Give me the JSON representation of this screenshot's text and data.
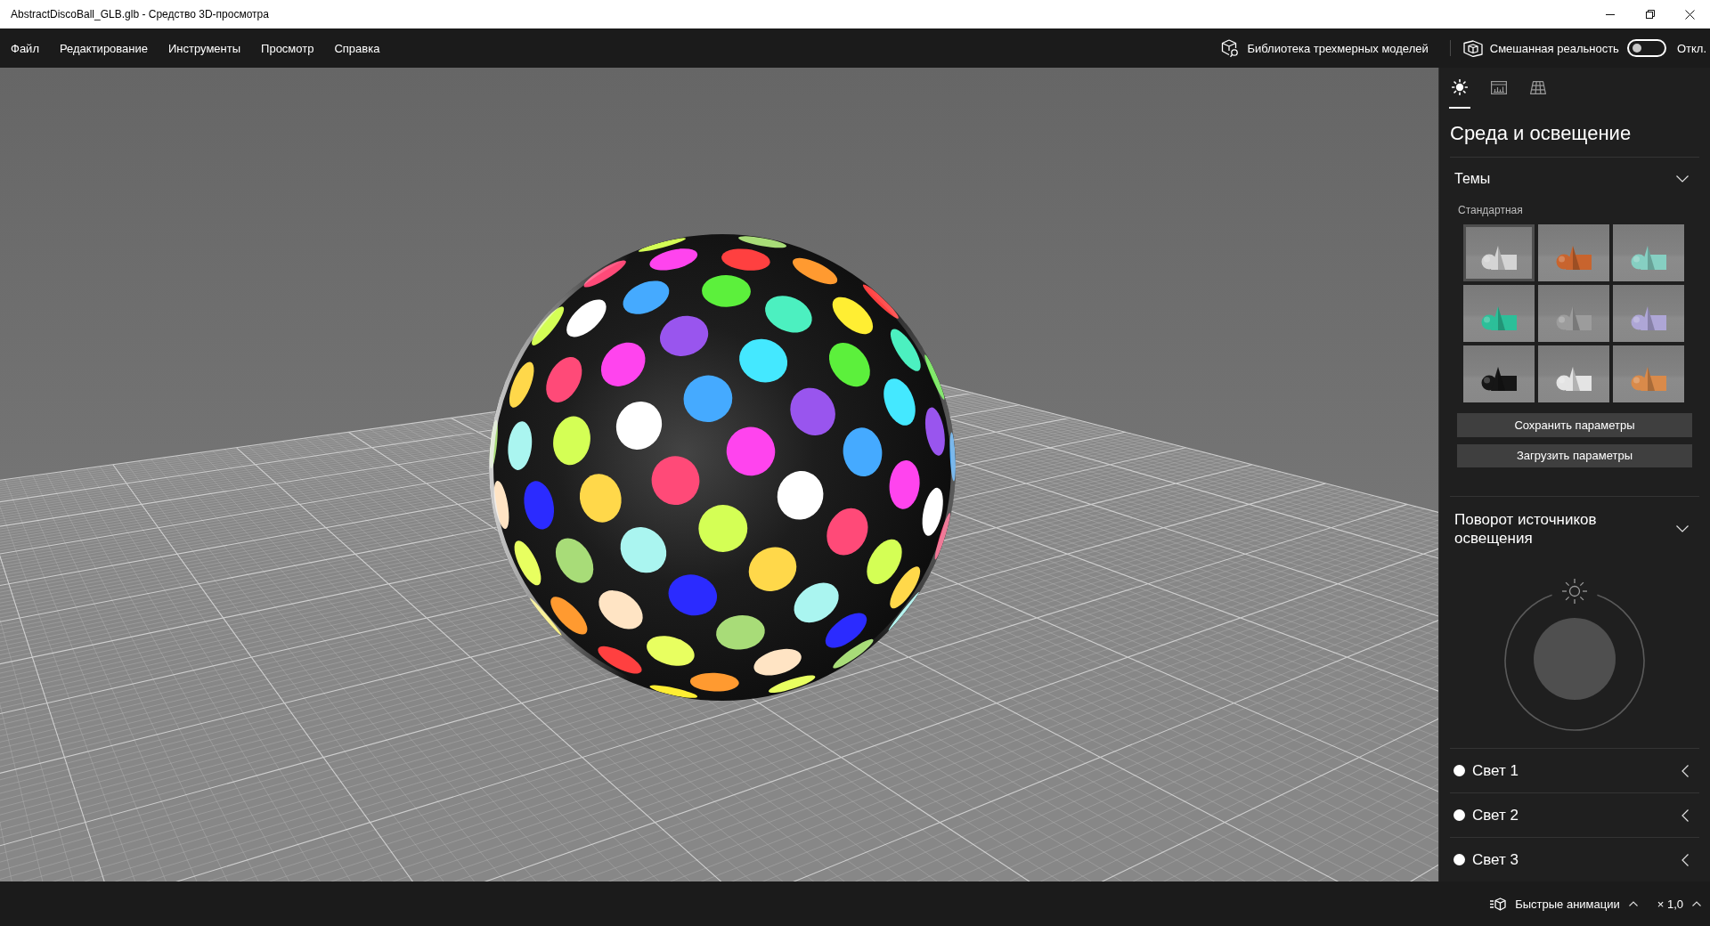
{
  "window": {
    "title": "AbstractDiscoBall_GLB.glb - Средство 3D-просмотра"
  },
  "menu_bar": {
    "items": [
      "Файл",
      "Редактирование",
      "Инструменты",
      "Просмотр",
      "Справка"
    ],
    "library_link": "Библиотека трехмерных моделей",
    "mixed_reality": {
      "label": "Смешанная реальность",
      "on": false,
      "state_text": "Откл."
    }
  },
  "side_panel": {
    "tabs": [
      {
        "selected": true
      },
      {
        "selected": false
      },
      {
        "selected": false
      }
    ],
    "title": "Среда и освещение",
    "themes": {
      "heading": "Темы",
      "expanded": true,
      "group_label": "Стандартная",
      "tiles": [
        {
          "color": "#d4d4d4",
          "selected": true
        },
        {
          "color": "#c8642e",
          "selected": false
        },
        {
          "color": "#86cfc2",
          "selected": false
        },
        {
          "color": "#2cbf99",
          "selected": false
        },
        {
          "color": "#9c9c9c",
          "selected": false
        },
        {
          "color": "#aea6d6",
          "selected": false
        },
        {
          "color": "#161616",
          "selected": false
        },
        {
          "color": "#e4e4e4",
          "selected": false
        },
        {
          "color": "#d98a4a",
          "selected": false
        }
      ],
      "buttons": [
        "Сохранить параметры",
        "Загрузить параметры"
      ]
    },
    "light_rotation": {
      "heading": "Поворот источников освещения",
      "expanded": true
    },
    "lights": [
      {
        "label": "Свет 1",
        "color": "#ffffff",
        "expanded": false
      },
      {
        "label": "Свет 2",
        "color": "#ffffff",
        "expanded": false
      },
      {
        "label": "Свет 3",
        "color": "#ffffff",
        "expanded": false
      }
    ]
  },
  "status_bar": {
    "animations_label": "Быстрые анимации",
    "speed": "× 1,0"
  }
}
